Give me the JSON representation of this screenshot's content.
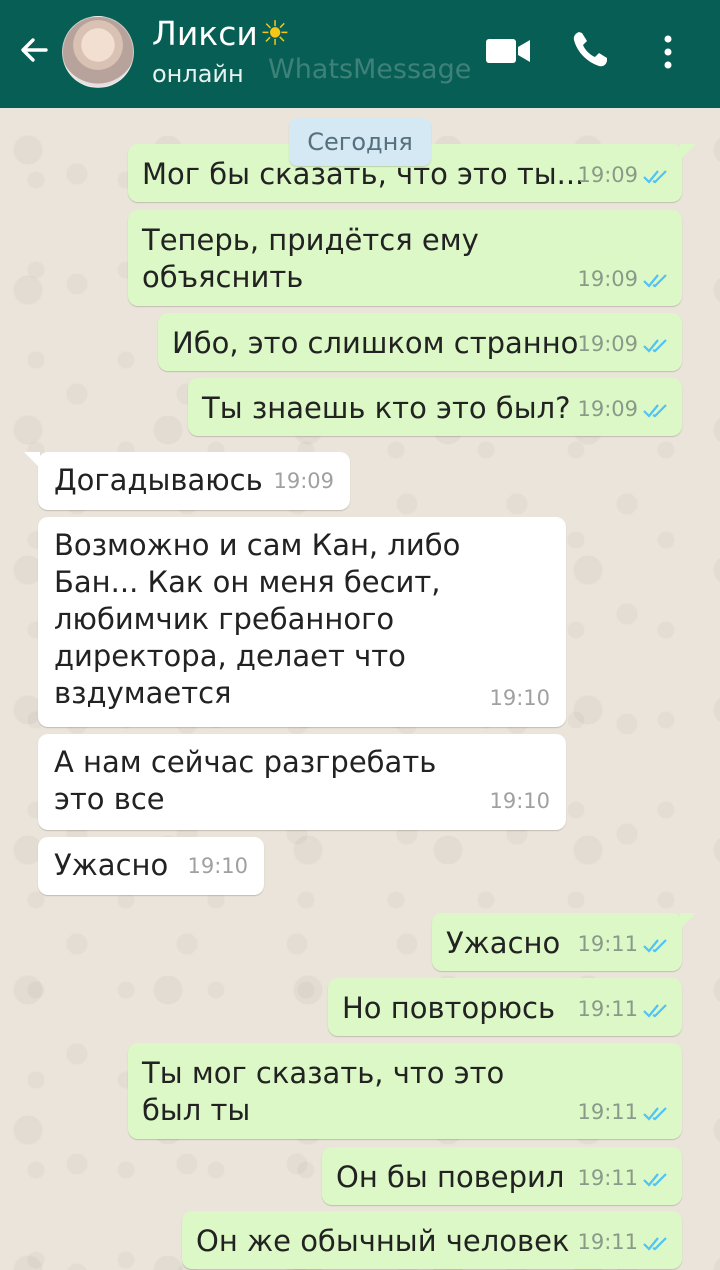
{
  "header": {
    "contact_name": "Ликси",
    "status": "онлайн",
    "watermark": "WhatsMessage"
  },
  "date_chip": "Сегодня",
  "messages": [
    {
      "dir": "out",
      "text": "Мог бы сказать, что это ты...",
      "time": "19:09"
    },
    {
      "dir": "out",
      "text": "Теперь, придётся ему объяснить",
      "time": "19:09"
    },
    {
      "dir": "out",
      "text": "Ибо, это слишком странно",
      "time": "19:09"
    },
    {
      "dir": "out",
      "text": "Ты знаешь кто это был?",
      "time": "19:09"
    },
    {
      "dir": "in",
      "text": "Догадываюсь",
      "time": "19:09"
    },
    {
      "dir": "in",
      "text": "Возможно и сам Кан, либо Бан... Как он меня бесит, любимчик гребанного директора, делает что вздумается",
      "time": "19:10"
    },
    {
      "dir": "in",
      "text": "А нам сейчас разгребать это все",
      "time": "19:10"
    },
    {
      "dir": "in",
      "text": "Ужасно",
      "time": "19:10"
    },
    {
      "dir": "out",
      "text": "Ужасно",
      "time": "19:11"
    },
    {
      "dir": "out",
      "text": "Но повторюсь",
      "time": "19:11"
    },
    {
      "dir": "out",
      "text": "Ты мог сказать, что это был ты",
      "time": "19:11"
    },
    {
      "dir": "out",
      "text": "Он бы поверил",
      "time": "19:11"
    },
    {
      "dir": "out",
      "text": "Он же обычный человек",
      "time": "19:11"
    }
  ],
  "colors": {
    "header": "#075e54",
    "outgoing_bubble": "#dcf8c6",
    "incoming_bubble": "#ffffff",
    "read_ticks": "#4fc3f7",
    "date_chip": "#d4e9f4"
  }
}
